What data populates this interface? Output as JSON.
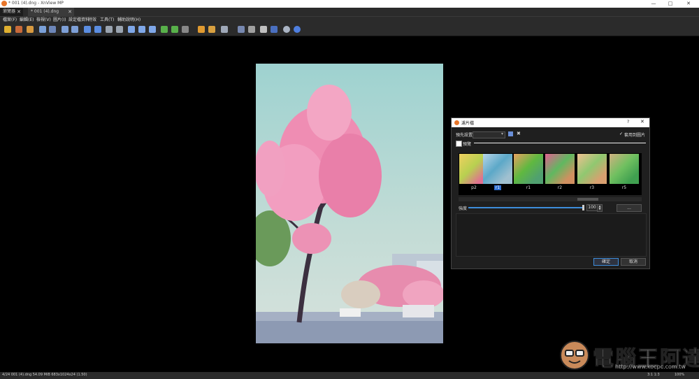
{
  "window": {
    "title": "* 001 (4).dng - XnView MP"
  },
  "tabs": [
    {
      "label": "瀏覽器"
    },
    {
      "label": "* 001 (4).dng"
    }
  ],
  "menu": [
    "檔案(F)",
    "編輯(E)",
    "檢視(V)",
    "圖片(I)",
    "設定檔資料",
    "特效",
    "工具(T)",
    "輔助說明(H)"
  ],
  "dialog": {
    "title": "濾片檔",
    "help": "?",
    "close": "✕",
    "preset_label": "預先設置:",
    "preset_value": "",
    "apply_all_label": "套用到圖片",
    "preview_label": "預覽",
    "filters": [
      "p2",
      "r1",
      "r1",
      "r2",
      "r3",
      "r5"
    ],
    "selected_filter": "r1",
    "strength_label": "強度",
    "strength_value": "100",
    "more_button": "...",
    "ok_button": "確定",
    "cancel_button": "取消"
  },
  "status": {
    "left": "4/24  001 (4).dng  54.09 MiB  683x1024x24 (1.50)",
    "right_zoom": "100%",
    "right_ratio": "3:1 1:3"
  },
  "watermark": {
    "text": "電腦王阿達",
    "url": "http://www.kocpc.com.tw"
  },
  "colors": {
    "accent": "#3d8ddb",
    "app_icon": "#e8762a"
  }
}
